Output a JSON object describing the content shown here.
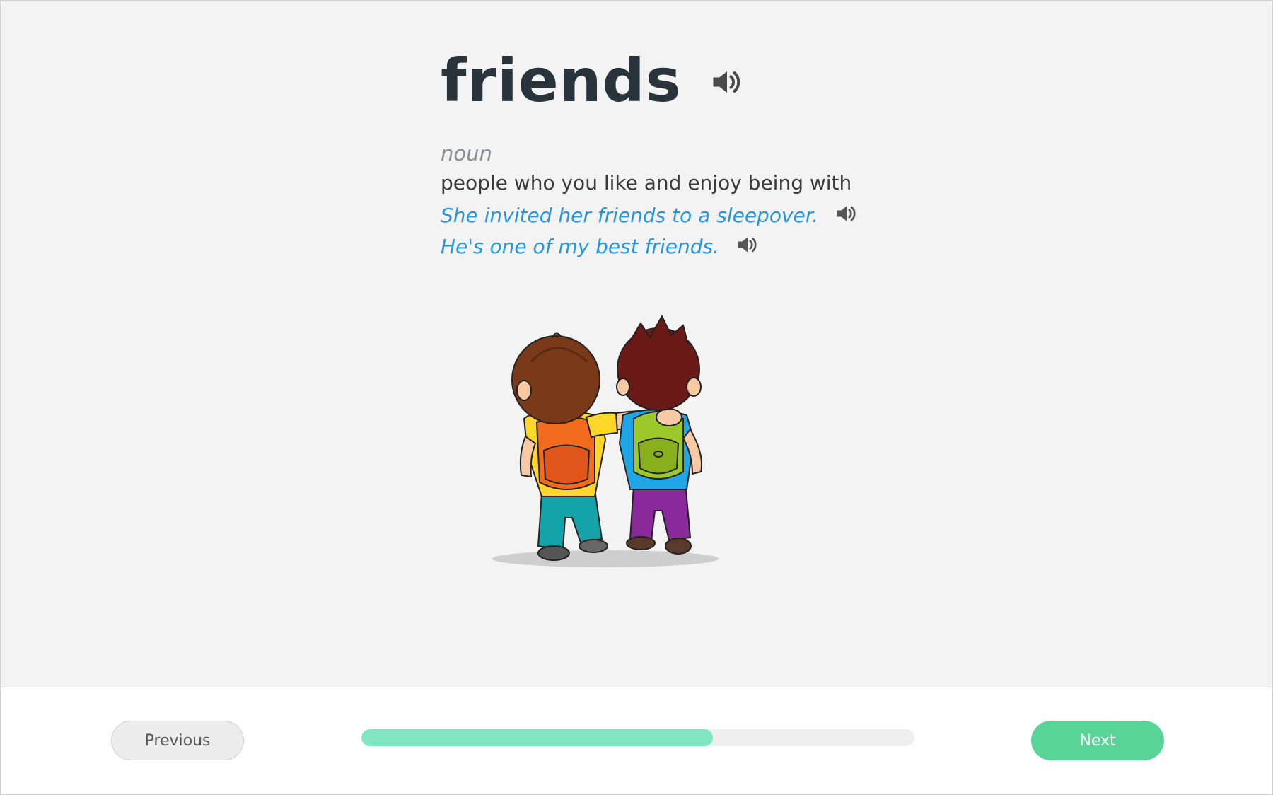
{
  "lesson": {
    "word": "friends",
    "part_of_speech": "noun",
    "definition": "people who you like and enjoy being with",
    "examples": [
      "She invited her friends to a sleepover.",
      "He's one of my best friends."
    ]
  },
  "icons": {
    "audio": "speaker-icon",
    "illustration": "two-friends-illustration"
  },
  "navigation": {
    "previous_label": "Previous",
    "next_label": "Next"
  },
  "progress": {
    "fraction": 0.635
  },
  "colors": {
    "example_text": "#2695e3",
    "next_button": "#58d497",
    "progress_fill": "#7fe6c1",
    "title": "#28333b"
  }
}
